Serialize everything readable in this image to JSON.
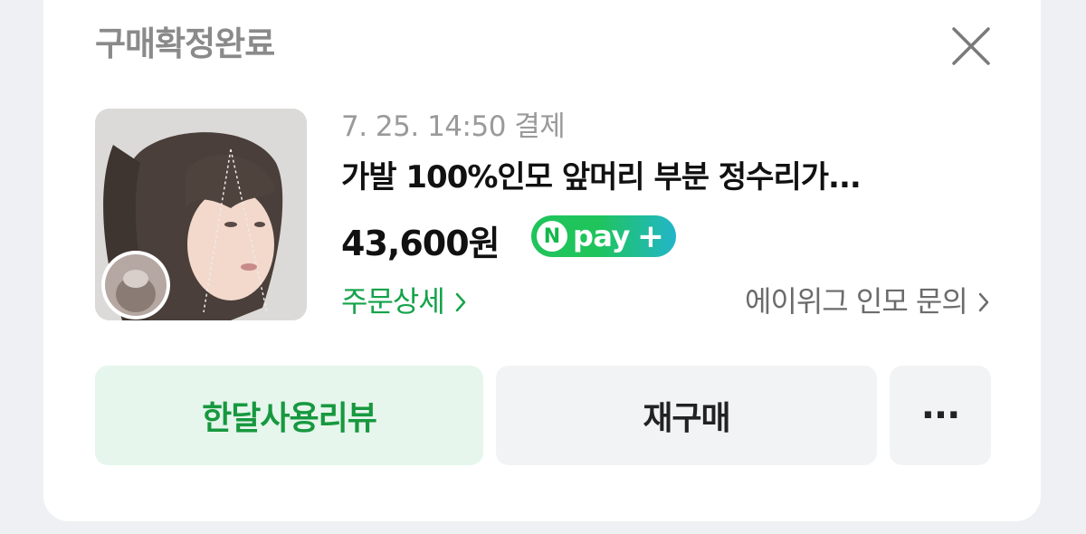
{
  "order": {
    "status": "구매확정완료",
    "paid_at": "7. 25. 14:50 결제",
    "product_title": "가발 100%인모 앞머리 부분 정수리가...",
    "price": "43,600원",
    "npay": {
      "n": "N",
      "text": "pay",
      "plus": "+"
    },
    "detail_link": "주문상세",
    "seller_inquiry": "에이위그 인모 문의"
  },
  "actions": {
    "review": "한달사용리뷰",
    "rebuy": "재구매",
    "more": "···"
  },
  "colors": {
    "accent_green": "#15a34a",
    "review_bg": "#e6f6ec",
    "neutral_bg": "#f2f3f5"
  },
  "icons": [
    "close-icon",
    "chevron-right-icon",
    "more-icon",
    "npay-logo"
  ]
}
